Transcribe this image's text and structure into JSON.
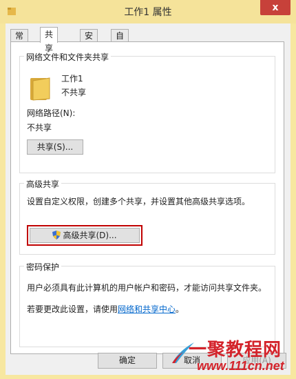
{
  "window": {
    "title": "工作1 属性",
    "close_glyph": "x"
  },
  "tabs": [
    {
      "label": "常规"
    },
    {
      "label": "共享",
      "active": true
    },
    {
      "label": "安全"
    },
    {
      "label": "自定义"
    }
  ],
  "network_share": {
    "title": "网络文件和文件夹共享",
    "folder_name": "工作1",
    "folder_status": "不共享",
    "path_label": "网络路径(N):",
    "path_value": "不共享",
    "share_button": "共享(S)..."
  },
  "advanced_share": {
    "title": "高级共享",
    "description": "设置自定义权限，创建多个共享，并设置其他高级共享选项。",
    "button": "高级共享(D)..."
  },
  "password": {
    "title": "密码保护",
    "description": "用户必须具有此计算机的用户帐户和密码，才能访问共享文件夹。",
    "change_prefix": "若要更改此设置，请使用",
    "link": "网络和共享中心",
    "change_suffix": "。"
  },
  "footer": {
    "ok": "确定",
    "cancel": "取消",
    "apply": "应用(A)"
  },
  "watermark": {
    "main": "一聚教程网",
    "sub": "www.111cn.net"
  }
}
